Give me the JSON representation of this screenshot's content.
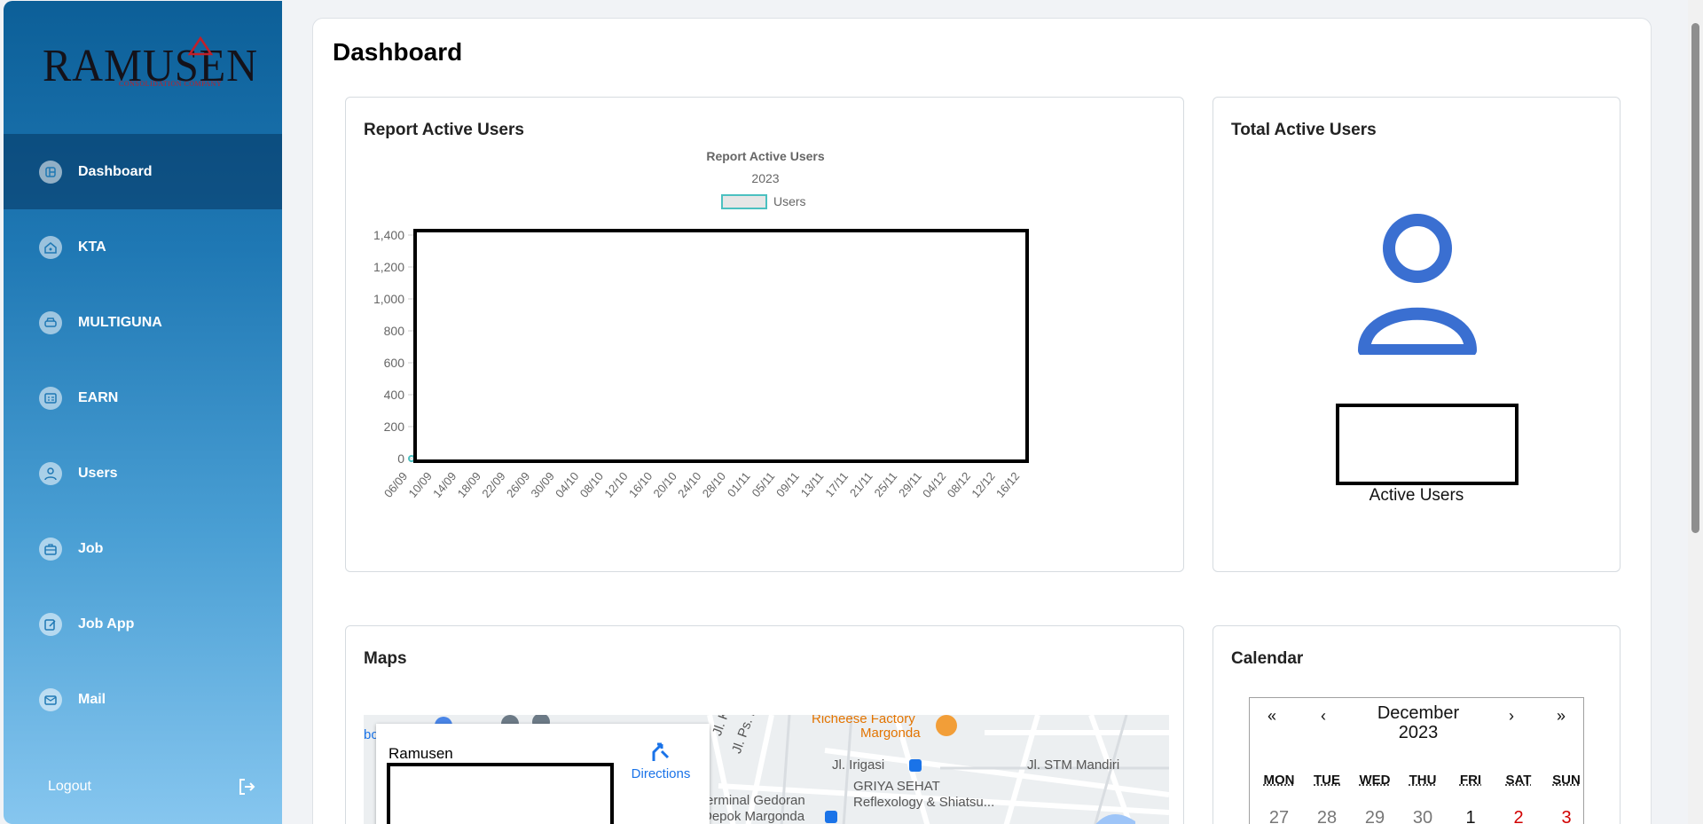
{
  "sidebar": {
    "logo": {
      "text": "RAMUSEN",
      "tagline": "CONSOLIDATION COMPANY"
    },
    "items": [
      {
        "label": "Dashboard",
        "icon": "dashboard-icon",
        "active": true
      },
      {
        "label": "KTA",
        "icon": "home-icon",
        "active": false
      },
      {
        "label": "MULTIGUNA",
        "icon": "car-icon",
        "active": false
      },
      {
        "label": "EARN",
        "icon": "id-card-icon",
        "active": false
      },
      {
        "label": "Users",
        "icon": "user-icon",
        "active": false
      },
      {
        "label": "Job",
        "icon": "briefcase-icon",
        "active": false
      },
      {
        "label": "Job App",
        "icon": "edit-icon",
        "active": false
      },
      {
        "label": "Mail",
        "icon": "mail-icon",
        "active": false
      }
    ],
    "logout_label": "Logout"
  },
  "main": {
    "title": "Dashboard",
    "report_panel": {
      "title": "Report Active Users"
    },
    "total_panel": {
      "title": "Total Active Users",
      "caption": "Active Users"
    },
    "maps_panel": {
      "title": "Maps",
      "place_name": "Ramusen",
      "directions_label": "Directions",
      "labels": [
        "Richeese Factory",
        "Margonda",
        "Jl. Irigasi",
        "GRIYA SEHAT",
        "Reflexology & Shiatsu...",
        "Jl. STM Mandiri",
        "erminal Gedoran",
        "Depok Margonda",
        "Jl. Ps. Kemiri",
        "Jl. Kom",
        "bo"
      ]
    },
    "calendar_panel": {
      "title": "Calendar",
      "month": "December",
      "year": "2023",
      "nav": [
        "«",
        "‹",
        "›",
        "»"
      ],
      "weekdays": [
        "MON",
        "TUE",
        "WED",
        "THU",
        "FRI",
        "SAT",
        "SUN"
      ],
      "first_week": [
        "27",
        "28",
        "29",
        "30",
        "1",
        "2",
        "3"
      ]
    }
  },
  "colors": {
    "accent": "#3a6fd1",
    "weekend": "#d10000",
    "sidebar_top": "#0c5f98",
    "sidebar_bottom": "#86c6ef",
    "series": "#4bc0c0"
  },
  "chart_data": {
    "type": "line",
    "title": "Report Active Users",
    "subtitle": "2023",
    "legend": "top",
    "series": [
      {
        "name": "Users",
        "values": []
      }
    ],
    "categories": [
      "06/09",
      "10/09",
      "14/09",
      "18/09",
      "22/09",
      "26/09",
      "30/09",
      "04/10",
      "08/10",
      "12/10",
      "16/10",
      "20/10",
      "24/10",
      "28/10",
      "01/11",
      "05/11",
      "09/11",
      "13/11",
      "17/11",
      "21/11",
      "25/11",
      "29/11",
      "04/12",
      "08/12",
      "12/12",
      "16/12"
    ],
    "yticks": [
      "1,400",
      "1,200",
      "1,000",
      "800",
      "600",
      "400",
      "200",
      "0"
    ],
    "ylim": [
      0,
      1400
    ]
  }
}
